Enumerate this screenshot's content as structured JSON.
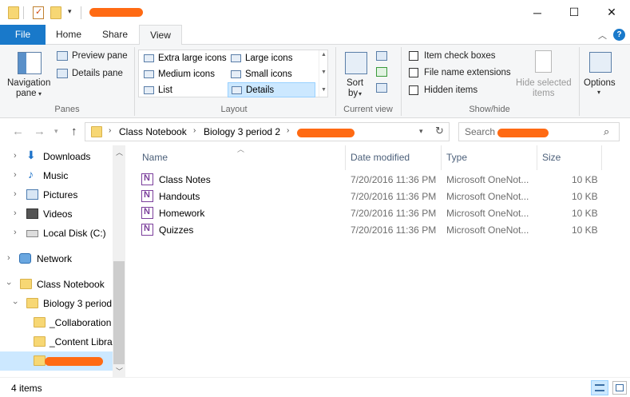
{
  "titlebar": {
    "qat_icons": [
      "folder-icon",
      "properties-icon",
      "new-folder-icon",
      "customize-qat-icon"
    ],
    "minimize": "─",
    "maximize": "☐",
    "close": "✕"
  },
  "ribbon_tabs": [
    "File",
    "Home",
    "Share",
    "View"
  ],
  "ribbon": {
    "panes": {
      "navigation_pane": "Navigation",
      "navigation_pane_2": "pane",
      "preview_pane": "Preview pane",
      "details_pane": "Details pane",
      "group_label": "Panes"
    },
    "layout": {
      "items": [
        "Extra large icons",
        "Large icons",
        "Medium icons",
        "Small icons",
        "List",
        "Details"
      ],
      "selected": "Details",
      "group_label": "Layout"
    },
    "current_view": {
      "sort_by": "Sort",
      "sort_by_2": "by",
      "group_label": "Current view"
    },
    "show_hide": {
      "item_check_boxes": "Item check boxes",
      "file_name_extensions": "File name extensions",
      "hidden_items": "Hidden items",
      "hide_selected": "Hide selected",
      "hide_selected_2": "items",
      "group_label": "Show/hide"
    },
    "options": "Options"
  },
  "address": {
    "breadcrumb": [
      "Class Notebook",
      "Biology 3 period 2"
    ],
    "search_placeholder": "Search"
  },
  "nav_pane": {
    "items": [
      {
        "label": "Downloads",
        "icon": "download-icon"
      },
      {
        "label": "Music",
        "icon": "music-icon"
      },
      {
        "label": "Pictures",
        "icon": "pictures-icon"
      },
      {
        "label": "Videos",
        "icon": "videos-icon"
      },
      {
        "label": "Local Disk (C:)",
        "icon": "disk-icon"
      },
      {
        "label": "Network",
        "icon": "network-icon"
      },
      {
        "label": "Class Notebook",
        "icon": "folder-icon"
      },
      {
        "label": "Biology 3 period",
        "icon": "folder-icon"
      },
      {
        "label": "_Collaboration",
        "icon": "folder-icon"
      },
      {
        "label": "_Content Libra",
        "icon": "folder-icon"
      }
    ]
  },
  "file_list": {
    "columns": [
      "Name",
      "Date modified",
      "Type",
      "Size"
    ],
    "rows": [
      {
        "name": "Class Notes",
        "date": "7/20/2016 11:36 PM",
        "type": "Microsoft OneNot...",
        "size": "10 KB"
      },
      {
        "name": "Handouts",
        "date": "7/20/2016 11:36 PM",
        "type": "Microsoft OneNot...",
        "size": "10 KB"
      },
      {
        "name": "Homework",
        "date": "7/20/2016 11:36 PM",
        "type": "Microsoft OneNot...",
        "size": "10 KB"
      },
      {
        "name": "Quizzes",
        "date": "7/20/2016 11:36 PM",
        "type": "Microsoft OneNot...",
        "size": "10 KB"
      }
    ]
  },
  "status": {
    "item_count": "4 items"
  },
  "colors": {
    "file_tab": "#1979ca",
    "selection": "#cce8ff",
    "redaction": "#ff6a13",
    "onenote": "#7b3f9c"
  }
}
